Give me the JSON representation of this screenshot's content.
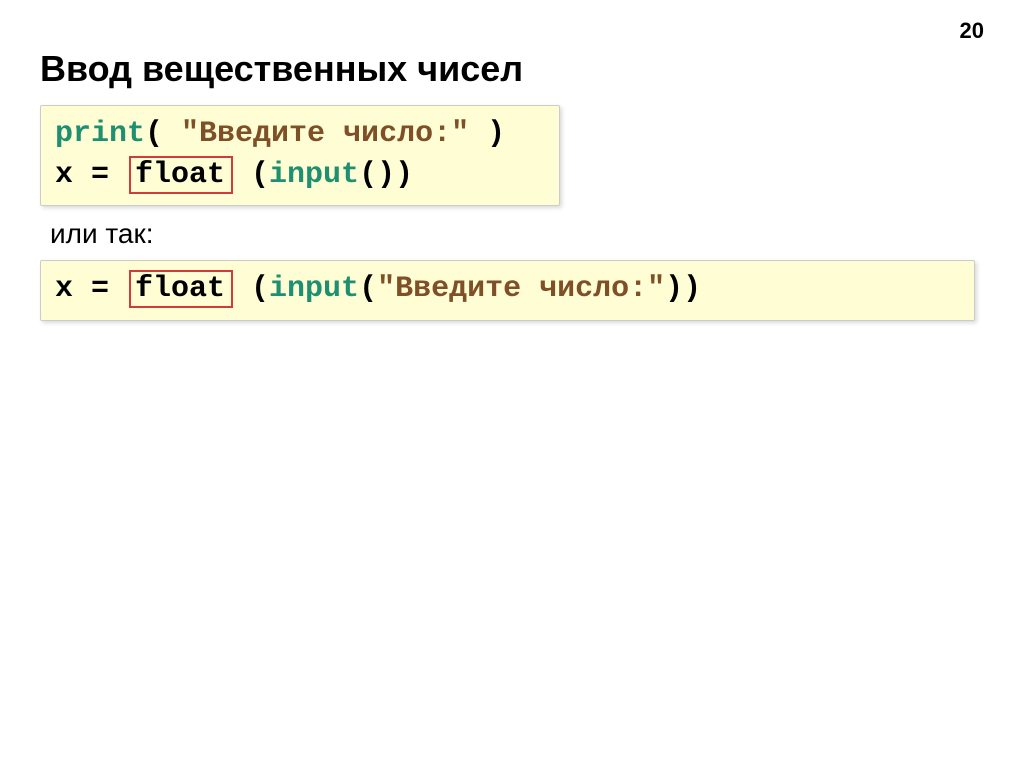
{
  "page_number": "20",
  "title": "Ввод вещественных чисел",
  "code1": {
    "line1": {
      "print_kw": "print",
      "open": "( ",
      "str": "\"Введите число:\"",
      "close": " )"
    },
    "line2": {
      "lhs": "x = ",
      "float_kw": "float",
      "open": " (",
      "input_kw": "input",
      "parens": "()",
      "close": ")"
    }
  },
  "between_label": "или так:",
  "code2": {
    "line1": {
      "lhs": "x = ",
      "float_kw": "float",
      "gap": "  (",
      "input_kw": "input",
      "open": "(",
      "str": "\"Введите число:\"",
      "close": "))"
    }
  }
}
